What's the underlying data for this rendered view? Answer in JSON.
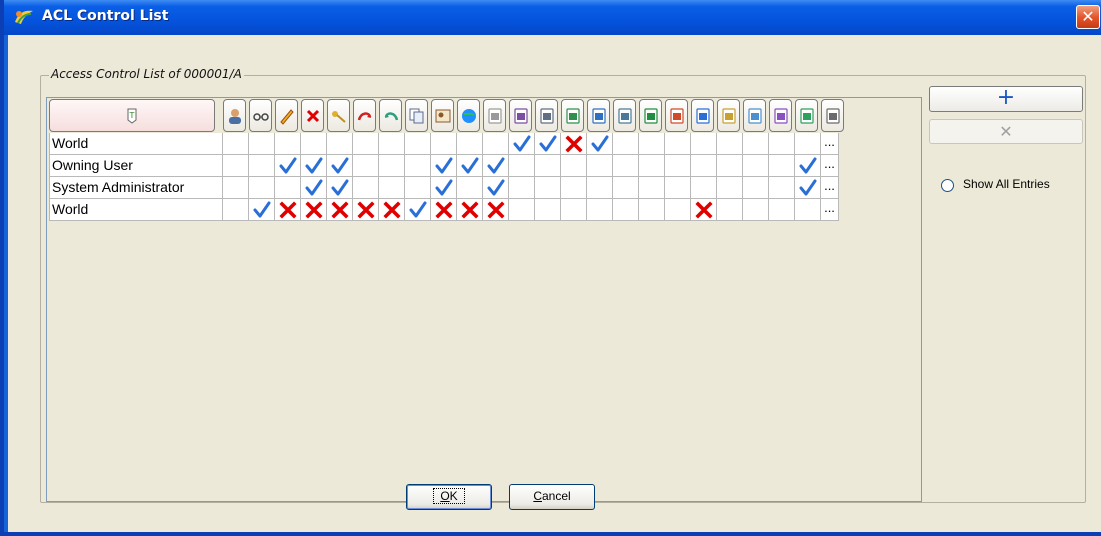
{
  "window": {
    "title": "ACL Control List",
    "close_label": "✕"
  },
  "group": {
    "label": "Access Control List of 000001/A"
  },
  "columns": [
    "accessor-header",
    "user-icon",
    "glasses-icon",
    "pencil-icon",
    "delete-x-icon",
    "key-icon",
    "arrow-right-icon",
    "undo-icon",
    "copy-icon",
    "person-card-icon",
    "globe-icon",
    "document-icon",
    "lock-arrow-icon",
    "lock-icon",
    "upload-icon",
    "download-icon",
    "list-icon",
    "move-icon",
    "flag-icon",
    "export-icon",
    "refresh-icon",
    "star-icon",
    "paste-icon",
    "swap-icon",
    "padlock-icon"
  ],
  "rows": [
    {
      "name": "World",
      "marks": [
        "",
        "",
        "",
        "",
        "",
        "",
        "",
        "",
        "",
        "",
        "",
        "check",
        "check",
        "X",
        "check",
        "",
        "",
        "",
        "",
        "",
        "",
        "",
        "",
        ""
      ]
    },
    {
      "name": "Owning User",
      "marks": [
        "",
        "",
        "check",
        "check",
        "check",
        "",
        "",
        "",
        "check",
        "check",
        "check",
        "",
        "",
        "",
        "",
        "",
        "",
        "",
        "",
        "",
        "",
        "",
        "check",
        ""
      ]
    },
    {
      "name": "System Administrator",
      "marks": [
        "",
        "",
        "",
        "check",
        "check",
        "",
        "",
        "",
        "check",
        "",
        "check",
        "",
        "",
        "",
        "",
        "",
        "",
        "",
        "",
        "",
        "",
        "",
        "check",
        ""
      ]
    },
    {
      "name": "World",
      "marks": [
        "",
        "check",
        "X",
        "X",
        "X",
        "X",
        "X",
        "check",
        "X",
        "X",
        "X",
        "",
        "",
        "",
        "",
        "",
        "",
        "",
        "X",
        "",
        "",
        "",
        "",
        ""
      ]
    }
  ],
  "ellipsis": "...",
  "side": {
    "add_label": "+",
    "remove_label": "✕",
    "show_all_label": "Show All Entries"
  },
  "buttons": {
    "ok": "OK",
    "ok_mnemonic": "O",
    "ok_rest": "K",
    "cancel": "Cancel",
    "cancel_mnemonic": "C",
    "cancel_rest": "ancel"
  },
  "colors": {
    "check": "#2a6fd6",
    "x": "#e00000",
    "title_bar": "#0553dc"
  }
}
